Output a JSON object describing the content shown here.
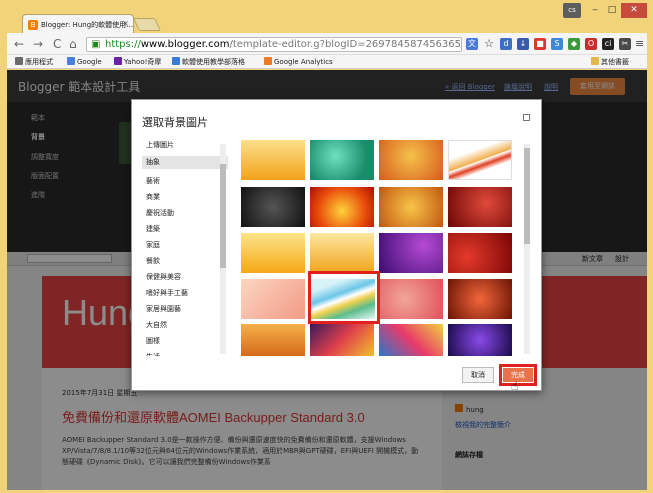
{
  "browser": {
    "tab_title": "Blogger: Hung的軟體使用…",
    "tab_favicon": "B",
    "window_user": "cs",
    "url_protocol": "https://",
    "url_host": "www.blogger.com",
    "url_path": "/template-editor.g?blogID=269784587456365",
    "bookmarks": [
      {
        "label": "應用程式",
        "icon": "apps-icon",
        "color": "#6b6b6b"
      },
      {
        "label": "Google",
        "icon": "google-icon",
        "color": "#4a7fe0"
      },
      {
        "label": "Yahoo!奇摩",
        "icon": "yahoo-icon",
        "color": "#6a1fb0"
      },
      {
        "label": "軟體使用教學部落格",
        "icon": "blogger-icon",
        "color": "#3a7cd8"
      },
      {
        "label": "Google Analytics",
        "icon": "analytics-icon",
        "color": "#e97a2a"
      }
    ],
    "other_bookmarks": "其他書籤"
  },
  "blogger": {
    "app_title": "Blogger 範本設計工具",
    "back_link": "« 返回 Blogger",
    "help_link": "說明",
    "community_link": "論壇說明",
    "apply_button": "套用至網誌",
    "sidebar_items": [
      "範本",
      "背景",
      "調整寬度",
      "版面配置",
      "進階"
    ],
    "preview_new_post": "新文章",
    "preview_design": "設計"
  },
  "blog_preview": {
    "banner_title": "Hung",
    "post_date": "2015年7月31日 星期五",
    "post_title": "免費備份和還原軟體AOMEI Backupper Standard 3.0",
    "post_text": "AOMEI Backupper Standard 3.0是一款操作方便、備份與還原速度快的免費備份和還原軟體，支援Windows XP/Vista/7/8/8.1/10等32位元與64位元的Windows作業系統，適用於MBR與GPT硬碟，EFI與UEFI 開機模式，動態硬碟《Dynamic Disk》。它可以讓我們完整備份Windows作業系",
    "author": "hung",
    "profile_link": "檢視我的完整簡介",
    "archive_heading": "網誌存檔"
  },
  "dialog": {
    "title": "選取背景圖片",
    "categories": [
      "上傳圖片",
      "抽象",
      "藝術",
      "商業",
      "慶祝活動",
      "建築",
      "家庭",
      "餐飲",
      "保健與美容",
      "嗜好與手工藝",
      "家居與園藝",
      "大自然",
      "圖樣",
      "生活"
    ],
    "selected_category": "抽象",
    "cancel_button": "取消",
    "done_button": "完成"
  },
  "colors": {
    "chrome_frame": "#f1d37a",
    "blogger_dark": "#3c3c3c",
    "apply_orange": "#f28b43",
    "banner_red": "#e94444",
    "highlight_red": "#e0211d"
  }
}
